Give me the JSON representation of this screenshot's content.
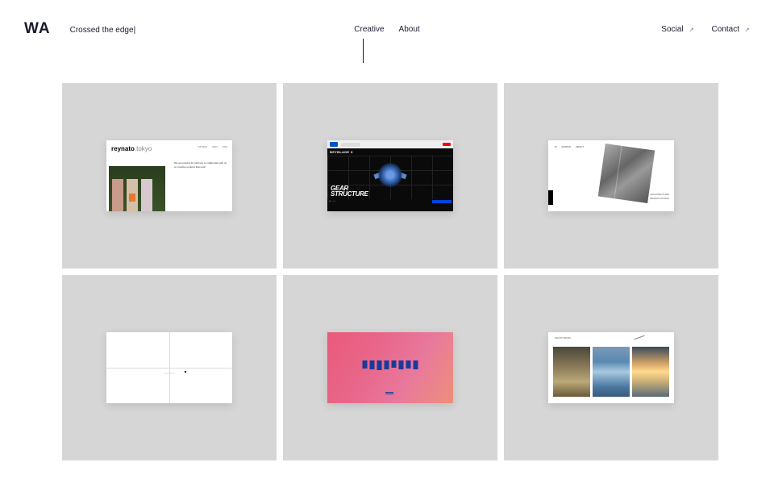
{
  "header": {
    "logo": "WA",
    "tagline": "Crossed the edge",
    "nav_center": [
      {
        "label": "Creative"
      },
      {
        "label": "About"
      }
    ],
    "nav_right": [
      {
        "label": "Social"
      },
      {
        "label": "Contact"
      }
    ]
  },
  "cards": [
    {
      "brand": "reynato",
      "brand_suffix": ".tokyo",
      "nav": [
        "STUDIO",
        "UNIT",
        "FAQ"
      ],
      "body_text": "We are looking for partners to collaborate with us on creative projects that push"
    },
    {
      "sublogo": "BEYBLADE X",
      "headline_top": "GEAR",
      "headline_bottom": "STRUCTURE"
    },
    {
      "nav": [
        "M",
        "WORKS",
        "ABOUT"
      ],
      "caption_a": "ARCHITECTURE",
      "caption_b": "DESIGN STUDIO"
    },
    {
      "center_text": "LOADING"
    },
    {},
    {
      "head": "PHOTO BOOK"
    }
  ]
}
